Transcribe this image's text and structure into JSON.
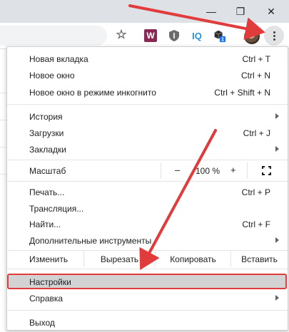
{
  "window": {
    "minimize_glyph": "—",
    "maximize_glyph": "❐",
    "close_glyph": "✕"
  },
  "toolbar": {
    "icons": [
      "star-icon",
      "extension-w-icon",
      "extension-shield-icon",
      "extension-iq-icon",
      "extension-cube-icon",
      "avatar",
      "kebab-menu-icon"
    ],
    "ext_w_label": "W",
    "ext_iq_label": "IQ",
    "ext_badge": "1",
    "star_glyph": "☆"
  },
  "menu": {
    "new_tab": {
      "label": "Новая вкладка",
      "shortcut": "Ctrl + T"
    },
    "new_window": {
      "label": "Новое окно",
      "shortcut": "Ctrl + N"
    },
    "incognito": {
      "label": "Новое окно в режиме инкогнито",
      "shortcut": "Ctrl + Shift + N"
    },
    "history": {
      "label": "История"
    },
    "downloads": {
      "label": "Загрузки",
      "shortcut": "Ctrl + J"
    },
    "bookmarks": {
      "label": "Закладки"
    },
    "zoom": {
      "label": "Масштаб",
      "minus": "–",
      "value": "100 %",
      "plus": "+"
    },
    "print": {
      "label": "Печать...",
      "shortcut": "Ctrl + P"
    },
    "cast": {
      "label": "Трансляция..."
    },
    "find": {
      "label": "Найти...",
      "shortcut": "Ctrl + F"
    },
    "more_tools": {
      "label": "Дополнительные инструменты"
    },
    "edit": {
      "label": "Изменить",
      "cut": "Вырезать",
      "copy": "Копировать",
      "paste": "Вставить"
    },
    "settings": {
      "label": "Настройки"
    },
    "help": {
      "label": "Справка"
    },
    "exit": {
      "label": "Выход"
    }
  },
  "annotation": {
    "arrow_color": "#e23b3b",
    "highlight_color": "#e23b3b"
  }
}
